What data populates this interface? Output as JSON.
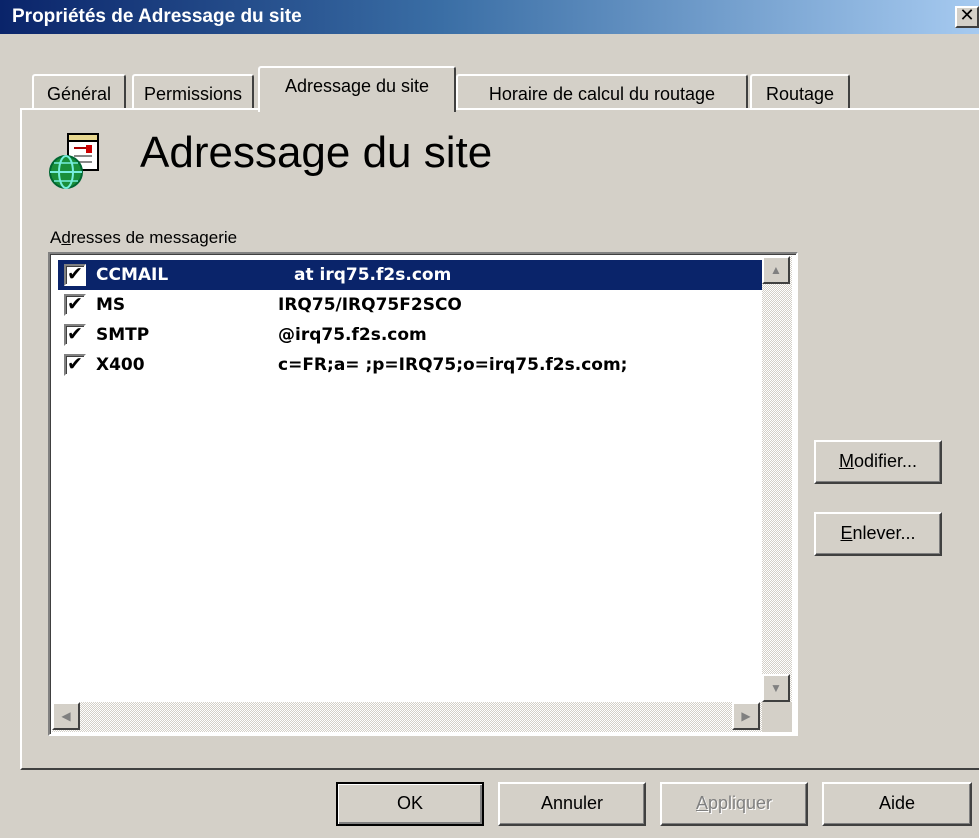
{
  "window": {
    "title": "Propriétés de Adressage du site",
    "close_glyph": "✕"
  },
  "tabs": [
    {
      "label": "Général"
    },
    {
      "label": "Permissions"
    },
    {
      "label": "Adressage du site"
    },
    {
      "label": "Horaire de calcul du routage"
    },
    {
      "label": "Routage"
    }
  ],
  "active_tab": "Adressage du site",
  "header": {
    "title": "Adressage du site",
    "icon": "site-addressing-icon"
  },
  "addresses": {
    "label": "Adresses de messagerie",
    "rows": [
      {
        "checked": true,
        "type": "CCMAIL",
        "address": "at irq75.f2s.com",
        "selected": true
      },
      {
        "checked": true,
        "type": "MS",
        "address": "IRQ75/IRQ75F2SCO",
        "selected": false
      },
      {
        "checked": true,
        "type": "SMTP",
        "address": "@irq75.f2s.com",
        "selected": false
      },
      {
        "checked": true,
        "type": "X400",
        "address": "c=FR;a= ;p=IRQ75;o=irq75.f2s.com;",
        "selected": false
      }
    ],
    "check_glyph": "✔"
  },
  "side_buttons": {
    "modify": "Modifier...",
    "remove": "Enlever..."
  },
  "footer_buttons": {
    "ok": "OK",
    "cancel": "Annuler",
    "apply": "Appliquer",
    "help": "Aide"
  },
  "scroll_glyphs": {
    "up": "▲",
    "down": "▼",
    "left": "◀",
    "right": "▶"
  },
  "colors": {
    "selection": "#0a246a",
    "dialog": "#d4d0c8"
  }
}
